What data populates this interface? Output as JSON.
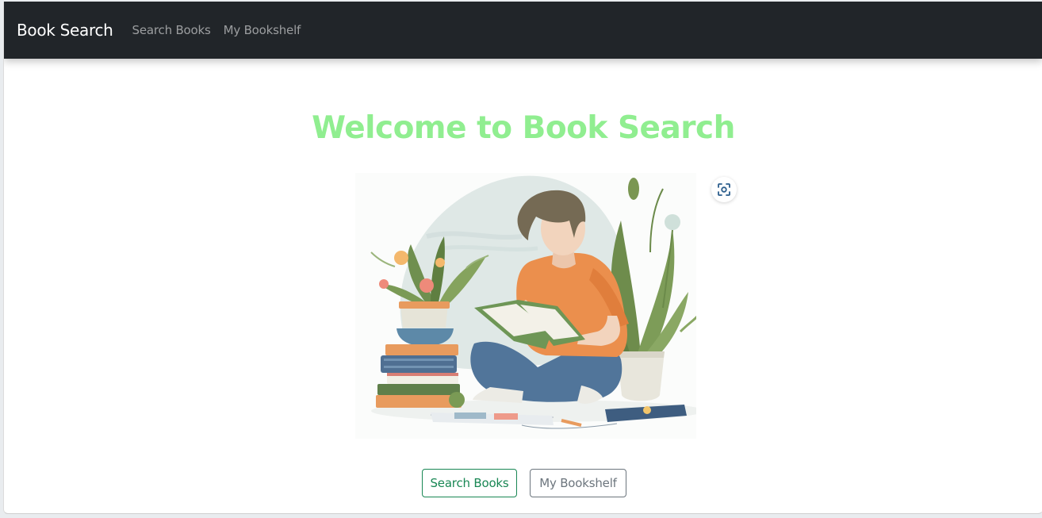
{
  "navbar": {
    "brand": "Book Search",
    "links": [
      "Search Books",
      "My Bookshelf"
    ]
  },
  "hero": {
    "title": "Welcome to Book Search",
    "title_color": "#90ee90"
  },
  "actions": {
    "search_label": "Search Books",
    "bookshelf_label": "My Bookshelf",
    "search_color": "#198754",
    "bookshelf_color": "#6c757d"
  },
  "icons": {
    "lens": "visual-search-icon"
  },
  "colors": {
    "navbar_bg": "#212529",
    "page_bg": "#ffffff"
  }
}
